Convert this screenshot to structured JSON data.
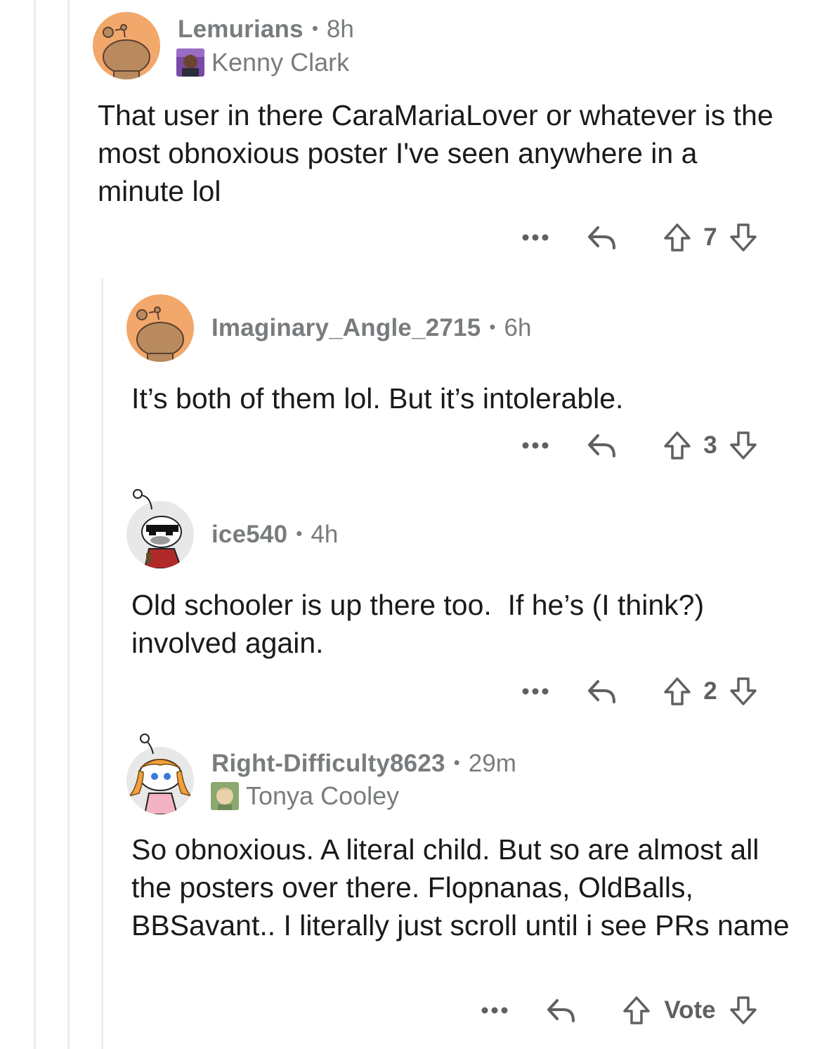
{
  "comments": [
    {
      "username": "Lemurians",
      "time": "8h",
      "flair": "Kenny Clark",
      "body": "That user in there CaraMariaLover or whatever is the most obnoxious poster I've seen anywhere in a minute lol",
      "votes": "7"
    },
    {
      "username": "Imaginary_Angle_2715",
      "time": "6h",
      "body": "It’s both of them lol. But it’s intolerable.",
      "votes": "3"
    },
    {
      "username": "ice540",
      "time": "4h",
      "body": "Old schooler is up there too.  If he’s (I think?) involved again.",
      "votes": "2"
    },
    {
      "username": "Right-Difficulty8623",
      "time": "29m",
      "flair": "Tonya Cooley",
      "body": "So obnoxious. A literal child. But so are almost all the posters over there. Flopnanas, OldBalls, BBSavant.. I literally just scroll until i see PRs name",
      "votes": "Vote"
    }
  ],
  "separator": "•",
  "icons": {
    "more": "more-options-icon",
    "reply": "reply-icon",
    "upvote": "upvote-arrow-icon",
    "downvote": "downvote-arrow-icon"
  },
  "colors": {
    "avatar_orange": "#f2a76b",
    "snoo_brown": "#b98a5e",
    "meta_gray": "#787c7e",
    "thread_line": "#ececec"
  }
}
